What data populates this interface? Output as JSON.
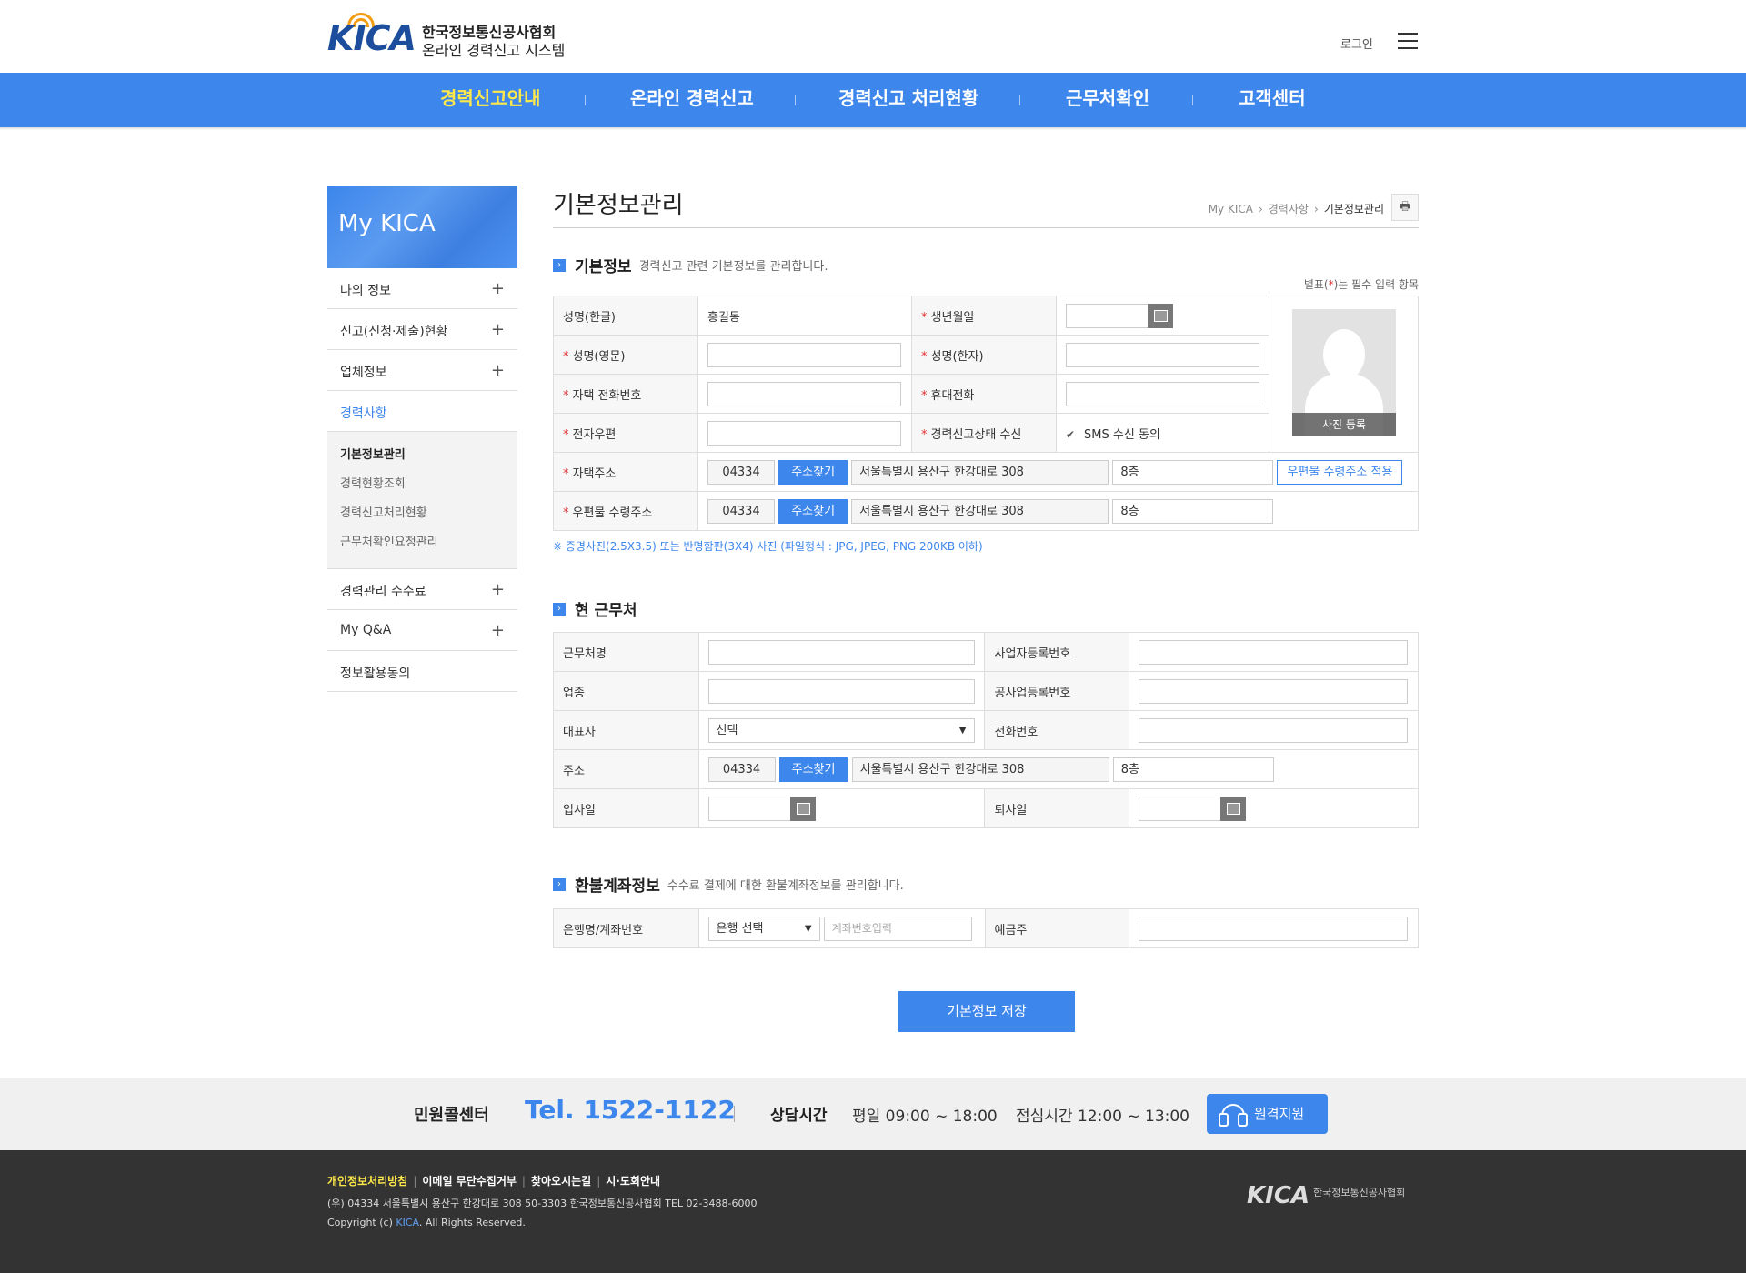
{
  "header": {
    "logo_mark": "KICA",
    "logo_line1": "한국정보통신공사협회",
    "logo_line2": "온라인 경력신고 시스템",
    "login_label": "로그인",
    "nav": [
      "경력신고안내",
      "온라인 경력신고",
      "경력신고 처리현황",
      "근무처확인",
      "고객센터"
    ]
  },
  "lnb": {
    "title": "My KICA",
    "items": [
      "나의 정보",
      "신고(신청·제출)현황",
      "업체정보",
      "경력사항"
    ],
    "sub": [
      "기본정보관리",
      "경력현황조회",
      "경력신고처리현황",
      "근무처확인요청관리"
    ],
    "items2": [
      "경력관리 수수료",
      "My Q&A",
      "정보활용동의"
    ],
    "plus": "+"
  },
  "page": {
    "title": "기본정보관리",
    "breadcrumb": [
      "My KICA",
      "경력사항",
      "기본정보관리"
    ],
    "print_icon": "🖶"
  },
  "basic": {
    "title": "기본정보",
    "desc": "경력신고 관련 기본정보를 관리합니다.",
    "req_note_pre": "별표(",
    "req_note_star": "*",
    "req_note_post": ")는 필수 입력 항목",
    "name_kr_label": "성명(한글)",
    "name_kr_value": "홍길동",
    "birth_label": "생년월일",
    "name_en_label": "성명(영문)",
    "name_hanja_label": "성명(한자)",
    "home_phone_label": "자택 전화번호",
    "mobile_label": "휴대전화",
    "email_label": "전자우편",
    "status_recv_label": "경력신고상태 수신",
    "sms_label": "SMS 수신 동의",
    "photo_label": "사진 등록",
    "home_addr_label": "자택주소",
    "mail_addr_label": "우편물 수령주소",
    "zip": "04334",
    "find_addr": "주소찾기",
    "addr1": "서울특별시 용산구 한강대로 308",
    "addr2": "8층",
    "apply_mail_addr": "우편물 수령주소 적용",
    "notice": "※ 증명사진(2.5X3.5) 또는 반명함판(3X4) 사진 (파일형식 : JPG, JPEG, PNG 200KB 이하)"
  },
  "work": {
    "title": "현 근무처",
    "company_label": "근무처명",
    "biz_no_label": "사업자등록번호",
    "industry_label": "업종",
    "constr_no_label": "공사업등록번호",
    "ceo_label": "대표자",
    "ceo_select": "선택",
    "tel_label": "전화번호",
    "addr_label": "주소",
    "zip": "04334",
    "find_addr": "주소찾기",
    "addr1": "서울특별시 용산구 한강대로 308",
    "addr2": "8층",
    "join_label": "입사일",
    "leave_label": "퇴사일"
  },
  "refund": {
    "title": "환불계좌정보",
    "desc": "수수료 결제에 대한 환불계좌정보를 관리합니다.",
    "bank_label": "은행명/계좌번호",
    "bank_select": "은행 선택",
    "account_placeholder": "계좌번호입력",
    "holder_label": "예금주"
  },
  "save_button": "기본정보 저장",
  "callbar": {
    "center": "민원콜센터",
    "tel": "Tel. 1522-1122",
    "hours_label": "상담시간",
    "hours": "평일 09:00 ~ 18:00",
    "lunch": "점심시간 12:00 ~ 13:00",
    "remote": "원격지원"
  },
  "footer": {
    "links": [
      "개인정보처리방침",
      "이메일 무단수집거부",
      "찾아오시는길",
      "시·도회안내"
    ],
    "address": "(우) 04334   서울특별시 용산구 한강대로 308 50-3303  한국정보통신공사협회  TEL 02-3488-6000",
    "copy_pre": "Copyright (c) ",
    "copy_brand": "KICA",
    "copy_post": ". All Rights Reserved.",
    "logo_mark": "KICA",
    "logo_name": "한국정보통신공사협회"
  }
}
